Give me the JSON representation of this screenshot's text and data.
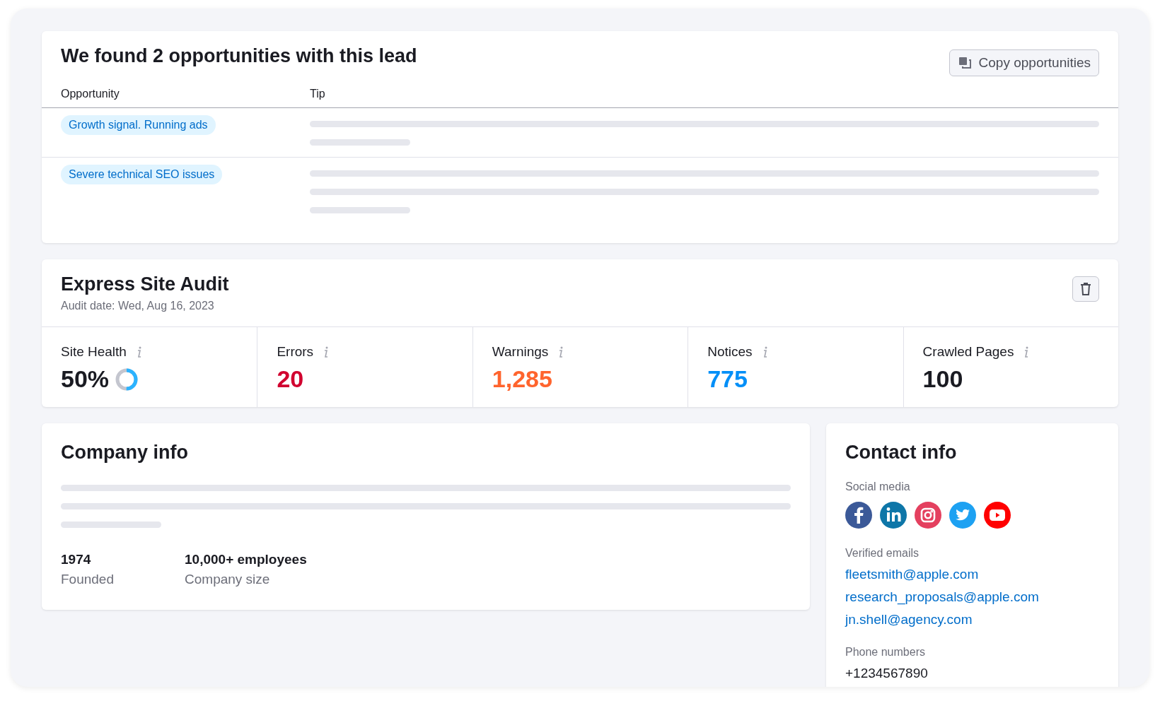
{
  "opportunities": {
    "title": "We found 2 opportunities with this lead",
    "copy_button": "Copy opportunities",
    "columns": [
      "Opportunity",
      "Tip"
    ],
    "rows": [
      {
        "tag": "Growth signal. Running ads",
        "tip_lines": [
          {
            "kind": "long"
          },
          {
            "kind": "short"
          }
        ]
      },
      {
        "tag": "Severe technical SEO issues",
        "tip_lines": [
          {
            "kind": "long"
          },
          {
            "kind": "long"
          },
          {
            "kind": "short"
          }
        ]
      }
    ]
  },
  "audit": {
    "title": "Express Site Audit",
    "date": "Audit date: Wed, Aug 16, 2023",
    "metrics": [
      {
        "label": "Site Health",
        "value": "50%",
        "color": "#1a1b22",
        "kind": "health",
        "level": 0.5
      },
      {
        "label": "Errors",
        "value": "20",
        "color": "#d1002f",
        "kind": "plain"
      },
      {
        "label": "Warnings",
        "value": "1,285",
        "color": "#ff642d",
        "kind": "plain"
      },
      {
        "label": "Notices",
        "value": "775",
        "color": "#008ff8",
        "kind": "plain"
      },
      {
        "label": "Crawled Pages",
        "value": "100",
        "color": "#1a1b22",
        "kind": "plain"
      }
    ]
  },
  "company": {
    "title": "Company info",
    "desc_lines": [
      {
        "kind": "long"
      },
      {
        "kind": "long"
      },
      {
        "kind": "short"
      }
    ],
    "stats": [
      {
        "value": "1974",
        "label": "Founded"
      },
      {
        "value": "10,000+ employees",
        "label": "Company size"
      }
    ]
  },
  "contact": {
    "title": "Contact info",
    "social_label": "Social media",
    "social": [
      {
        "kind": "facebook",
        "color": "#3b5998"
      },
      {
        "kind": "linkedin",
        "color": "#0e76a8"
      },
      {
        "kind": "instagram",
        "color": "#e4405f"
      },
      {
        "kind": "twitter",
        "color": "#1da1f2"
      },
      {
        "kind": "youtube",
        "color": "#ff0000"
      }
    ],
    "emails_label": "Verified emails",
    "emails": [
      "fleetsmith@apple.com",
      "research_proposals@apple.com",
      "jn.shell@agency.com"
    ],
    "phones_label": "Phone numbers",
    "phones": [
      "+1234567890"
    ]
  }
}
